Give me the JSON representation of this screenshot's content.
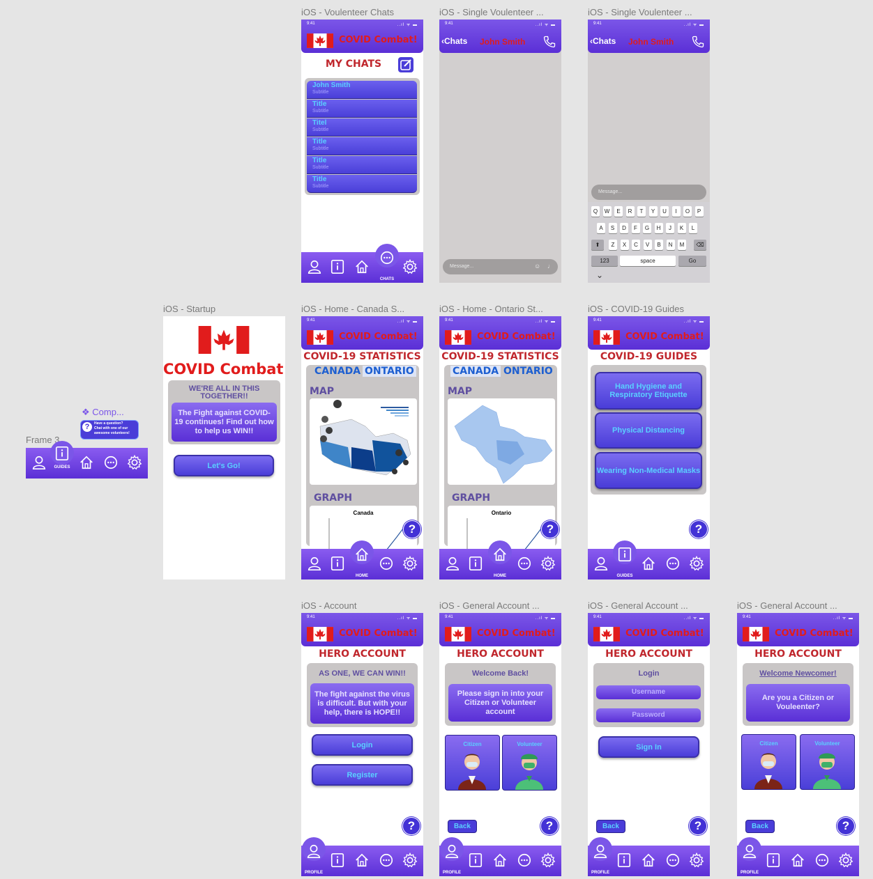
{
  "brand": "COVID Combat!",
  "status_time": "9:41",
  "status_icons": "..ıl ᯤ ▬",
  "colors": {
    "purple": "#5b2fd6",
    "brand_red": "#e11c1c",
    "title_red": "#c0272d",
    "link_blue": "#5ad0ff",
    "canvas_bg": "#e5e5e5"
  },
  "frame_labels": {
    "chats": "iOS - Voulenteer Chats",
    "single1": "iOS - Single Voulenteer ...",
    "single2": "iOS - Single Voulenteer ...",
    "startup": "iOS - Startup",
    "home_canada": "iOS - Home - Canada S...",
    "home_ontario": "iOS - Home - Ontario St...",
    "guides": "iOS - COVID-19 Guides",
    "account": "iOS - Account",
    "general1": "iOS - General Account ...",
    "general2": "iOS - General Account ...",
    "general3": "iOS - General Account ...",
    "frame3": "Frame 3",
    "component": "❖ Comp..."
  },
  "component_tip": [
    "Have a question?",
    "Chat with one of our",
    "awesome volunteers!"
  ],
  "nav": {
    "profile": "PROFILE",
    "guides": "GUIDES",
    "home": "HOME",
    "chats": "CHATS"
  },
  "icons": [
    "profile-icon",
    "guides-icon",
    "home-icon",
    "chat-icon",
    "gear-icon",
    "compose-icon",
    "phone-icon",
    "help-icon",
    "flag-icon"
  ],
  "chats": {
    "title": "MY CHATS",
    "items": [
      {
        "title": "John Smith",
        "subtitle": "Subtitle"
      },
      {
        "title": "Title",
        "subtitle": "Subtitle"
      },
      {
        "title": "Titel",
        "subtitle": "Subtitle"
      },
      {
        "title": "Title",
        "subtitle": "Subtitle"
      },
      {
        "title": "Title",
        "subtitle": "Subtitle"
      },
      {
        "title": "Title",
        "subtitle": "Subtitle"
      }
    ]
  },
  "single": {
    "back": "Chats",
    "name": "John Smith",
    "message_placeholder": "Message..."
  },
  "keyboard": {
    "row1": [
      "Q",
      "W",
      "E",
      "R",
      "T",
      "Y",
      "U",
      "I",
      "O",
      "P"
    ],
    "row2": [
      "A",
      "S",
      "D",
      "F",
      "G",
      "H",
      "J",
      "K",
      "L"
    ],
    "row3": [
      "Z",
      "X",
      "C",
      "V",
      "B",
      "N",
      "M"
    ],
    "num": "123",
    "space": "space",
    "go": "Go"
  },
  "startup": {
    "brand": "COVID Combat!",
    "tagline": "WE'RE ALL IN THIS TOGETHER!!",
    "card": "The Fight against COVID-19 continues! Find out how to help us WIN!!",
    "button": "Let's Go!"
  },
  "stats": {
    "title": "COVID-19 STATISTICS",
    "tab_canada": "CANADA",
    "tab_ontario": "ONTARIO",
    "map": "MAP",
    "graph": "GRAPH",
    "graph_title_canada": "Canada",
    "graph_title_ontario": "Ontario"
  },
  "guides": {
    "title": "COVID-19 GUIDES",
    "items": [
      "Hand Hygiene and Respiratory Etiquette",
      "Physical Distancing",
      "Wearing Non-Medical Masks"
    ]
  },
  "account": {
    "title": "HERO ACCOUNT",
    "slogan": "AS ONE, WE CAN WIN!!",
    "card": "The fight against the virus is difficult. But with your help, there is HOPE!!",
    "login": "Login",
    "register": "Register"
  },
  "general1": {
    "welcome": "Welcome Back!",
    "card": "Please sign in into your Citizen or Volunteer account",
    "citizen": "Citizen",
    "volunteer": "Volunteer",
    "back": "Back"
  },
  "general2": {
    "login": "Login",
    "username": "Username",
    "password": "Password",
    "signin": "Sign In",
    "back": "Back"
  },
  "general3": {
    "welcome": "Welcome Newcomer!",
    "card": "Are you a Citizen or Vouleenter?",
    "citizen": "Citizen",
    "volunteer": "Volunteer",
    "back": "Back"
  },
  "help_glyph": "?"
}
